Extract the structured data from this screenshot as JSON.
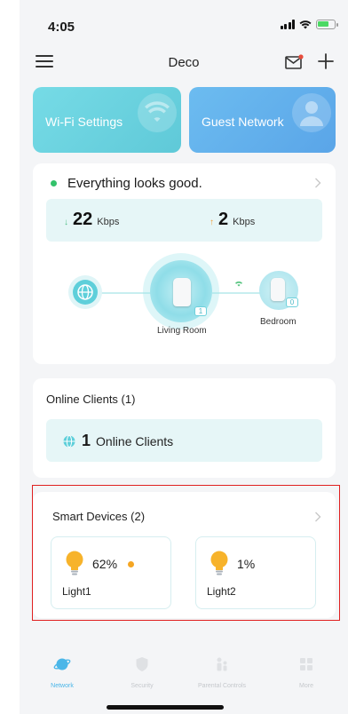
{
  "status_bar": {
    "time": "4:05"
  },
  "header": {
    "title": "Deco"
  },
  "top_cards": {
    "wifi_label": "Wi-Fi Settings",
    "guest_label": "Guest Network"
  },
  "network_status": {
    "message": "Everything looks good.",
    "download_value": "22",
    "download_unit": "Kbps",
    "upload_value": "2",
    "upload_unit": "Kbps",
    "main_node": {
      "name": "Living Room",
      "badge": "1"
    },
    "satellite_node": {
      "name": "Bedroom",
      "badge": "0"
    }
  },
  "online_clients": {
    "title": "Online Clients (1)",
    "count": "1",
    "label": "Online Clients"
  },
  "smart_devices": {
    "title": "Smart Devices (2)",
    "devices": [
      {
        "name": "Light1",
        "brightness": "62%"
      },
      {
        "name": "Light2",
        "brightness": "1%"
      }
    ]
  },
  "tabs": [
    {
      "label": "Network",
      "active": true
    },
    {
      "label": "Security",
      "active": false
    },
    {
      "label": "Parental Controls",
      "active": false
    },
    {
      "label": "More",
      "active": false
    }
  ],
  "colors": {
    "accent": "#5ecfda",
    "good": "#33c26b",
    "alert": "#f5a623",
    "highlight": "#e02020"
  }
}
